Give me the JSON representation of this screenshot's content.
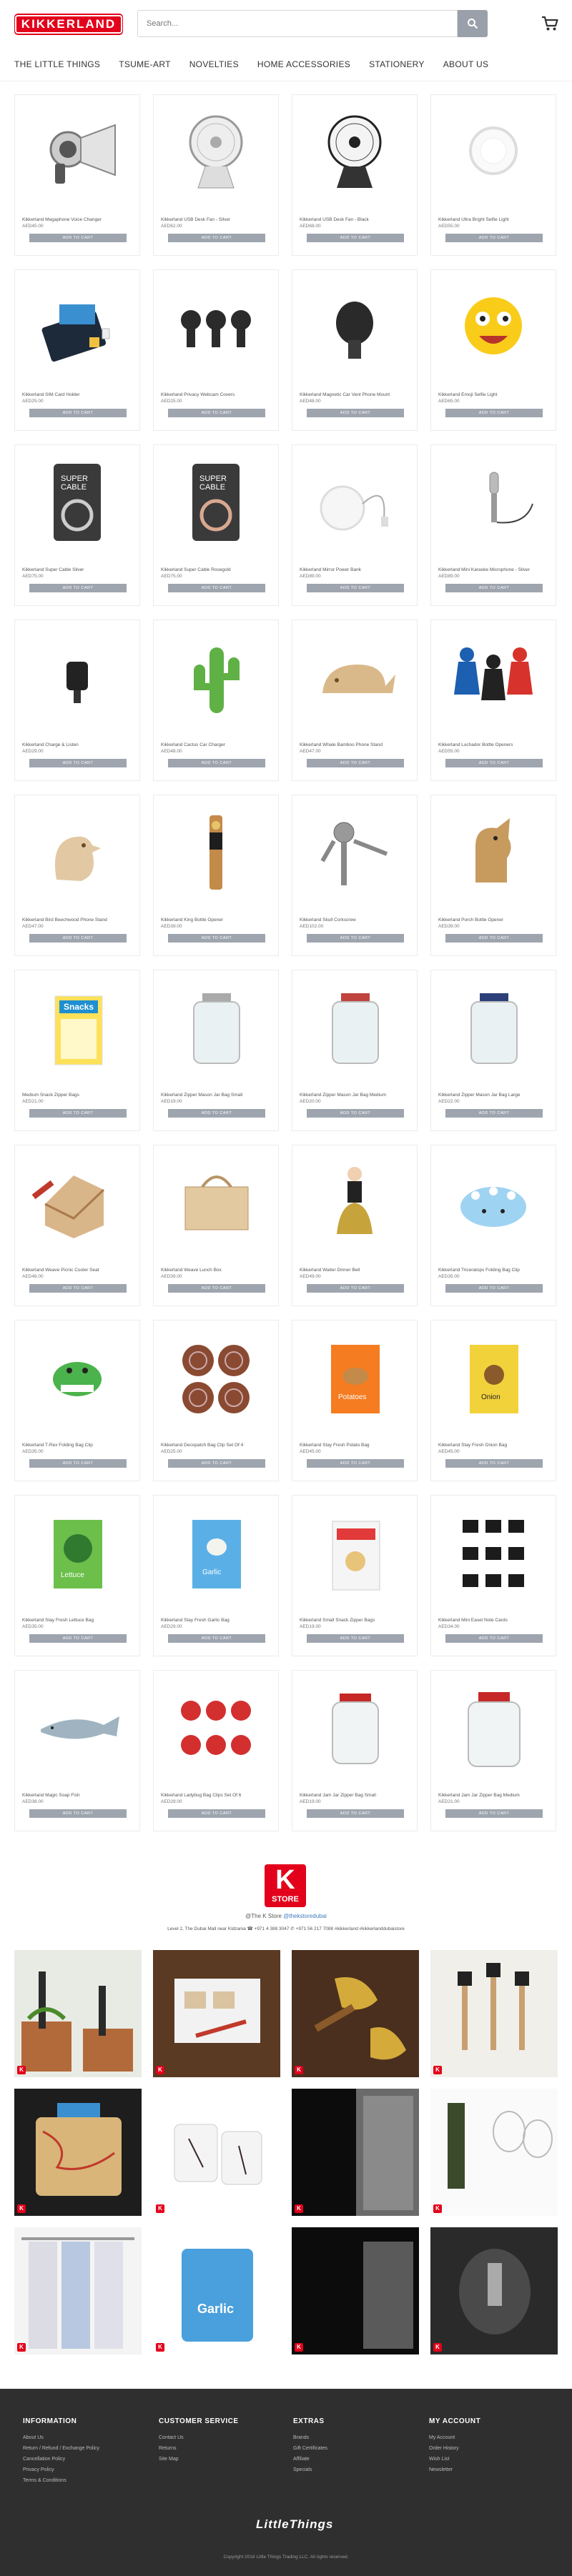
{
  "header": {
    "logo_text": "KIKKERLAND",
    "search_placeholder": "Search..."
  },
  "nav": [
    "THE LITTLE THINGS",
    "TSUME-ART",
    "NOVELTIES",
    "HOME ACCESSORIES",
    "STATIONERY",
    "ABOUT US"
  ],
  "add_label": "ADD TO CART",
  "products": [
    {
      "name": "Kikkerland Megaphone Voice Changer",
      "price": "AED45.00",
      "img": "megaphone"
    },
    {
      "name": "Kikkerland USB Desk Fan - Silver",
      "price": "AED62.00",
      "img": "fan-silver"
    },
    {
      "name": "Kikkerland USB Desk Fan - Black",
      "price": "AED68.00",
      "img": "fan-black"
    },
    {
      "name": "Kikkerland Ultra Bright Selfie Light",
      "price": "AED55.00",
      "img": "selfie-light"
    },
    {
      "name": "Kikkerland SIM Card Holder",
      "price": "AED25.00",
      "img": "sim-holder"
    },
    {
      "name": "Kikkerland Privacy Webcam Covers",
      "price": "AED25.00",
      "img": "webcam-covers"
    },
    {
      "name": "Kikkerland Magnetic Car Vent Phone Mount",
      "price": "AED48.00",
      "img": "car-mount"
    },
    {
      "name": "Kikkerland Emoji Selfie Light",
      "price": "AED65.00",
      "img": "emoji-light"
    },
    {
      "name": "Kikkerland Super Cable Silver",
      "price": "AED75.00",
      "img": "cable-silver"
    },
    {
      "name": "Kikkerland Super Cable Rosegold",
      "price": "AED75.00",
      "img": "cable-rose"
    },
    {
      "name": "Kikkerland Mirror Power Bank",
      "price": "AED89.00",
      "img": "power-bank"
    },
    {
      "name": "Kikkerland Mini Karaoke Microphone - Silver",
      "price": "AED89.00",
      "img": "microphone"
    },
    {
      "name": "Kikkerland Charge & Listen",
      "price": "AED29.00",
      "img": "charge-listen"
    },
    {
      "name": "Kikkerland Cactus Car Charger",
      "price": "AED48.00",
      "img": "cactus"
    },
    {
      "name": "Kikkerland Whale Bamboo Phone Stand",
      "price": "AED47.00",
      "img": "whale"
    },
    {
      "name": "Kikkerland Luchador Bottle Openers",
      "price": "AED55.00",
      "img": "luchador"
    },
    {
      "name": "Kikkerland Bird Beechwood Phone Stand",
      "price": "AED47.00",
      "img": "bird"
    },
    {
      "name": "Kikkerland King Bottle Opener",
      "price": "AED39.00",
      "img": "king-opener"
    },
    {
      "name": "Kikkerland Skull Corkscrew",
      "price": "AED102.00",
      "img": "corkscrew"
    },
    {
      "name": "Kikkerland Porch Bottle Opener",
      "price": "AED39.00",
      "img": "porch-opener"
    },
    {
      "name": "Medium Snack Zipper Bags",
      "price": "AED21.00",
      "img": "snack-bags"
    },
    {
      "name": "Kikkerland Zipper Mason Jar Bag Small",
      "price": "AED19.00",
      "img": "jar-small"
    },
    {
      "name": "Kikkerland Zipper Mason Jar Bag Medium",
      "price": "AED20.00",
      "img": "jar-medium"
    },
    {
      "name": "Kikkerland Zipper Mason Jar Bag Large",
      "price": "AED22.00",
      "img": "jar-large"
    },
    {
      "name": "Kikkerland Weave Picnic Cooler Seat",
      "price": "AED48.00",
      "img": "picnic-seat"
    },
    {
      "name": "Kikkerland Weave Lunch Box",
      "price": "AED39.00",
      "img": "lunch-box"
    },
    {
      "name": "Kikkerland Waiter Dinner Bell",
      "price": "AED49.00",
      "img": "dinner-bell"
    },
    {
      "name": "Kikkerland Triceratops Folding Bag Clip",
      "price": "AED35.00",
      "img": "triceratops"
    },
    {
      "name": "Kikkerland T-Rex Folding Bag Clip",
      "price": "AED35.00",
      "img": "trex"
    },
    {
      "name": "Kikkerland Decopatch Bag Clip Set Of 4",
      "price": "AED25.00",
      "img": "bag-clips"
    },
    {
      "name": "Kikkerland Stay Fresh Potato Bag",
      "price": "AED45.00",
      "img": "potato-bag"
    },
    {
      "name": "Kikkerland Stay Fresh Onion Bag",
      "price": "AED45.00",
      "img": "onion-bag"
    },
    {
      "name": "Kikkerland Stay Fresh Lettuce Bag",
      "price": "AED35.00",
      "img": "lettuce-bag"
    },
    {
      "name": "Kikkerland Stay Fresh Garlic Bag",
      "price": "AED29.00",
      "img": "garlic-bag"
    },
    {
      "name": "Kikkerland Small Snack Zipper Bags",
      "price": "AED19.00",
      "img": "small-snack"
    },
    {
      "name": "Kikkerland Mini Easel Note Cards",
      "price": "AED34.00",
      "img": "easel-cards"
    },
    {
      "name": "Kikkerland Magic Soap Fish",
      "price": "AED38.00",
      "img": "soap-fish"
    },
    {
      "name": "Kikkerland Ladybug Bag Clips Set Of 6",
      "price": "AED29.00",
      "img": "ladybug"
    },
    {
      "name": "Kikkerland Jam Jar Zipper Bag Small",
      "price": "AED19.00",
      "img": "jam-small"
    },
    {
      "name": "Kikkerland Jam Jar Zipper Bag Medium",
      "price": "AED21.00",
      "img": "jam-medium"
    }
  ],
  "social": {
    "store_letter": "K",
    "store_label": "STORE",
    "handle_prefix": "@The K Store",
    "handle_link": "@thekstoredubai",
    "address": "Level 2, The Dubai Mall near Kidzania  ☎ +971 4 388 3047  ✆ +971 56 217 7088  #kikkerland #kikkerlanddubaistore"
  },
  "instagram": [
    "garden-markers",
    "seed-tray",
    "gold-trowel",
    "mini-tools",
    "map-bag",
    "rose-cups",
    "dark-doorway",
    "wine-glasses",
    "shirts",
    "garlic-bag-photo",
    "dark-kitchen",
    "bottle-opener-hand"
  ],
  "footer": {
    "columns": [
      {
        "title": "INFORMATION",
        "links": [
          "About Us",
          "Return / Refund / Exchange Policy",
          "Cancellation Policy",
          "Privacy Policy",
          "Terms & Conditions"
        ]
      },
      {
        "title": "CUSTOMER SERVICE",
        "links": [
          "Contact Us",
          "Returns",
          "Site Map"
        ]
      },
      {
        "title": "EXTRAS",
        "links": [
          "Brands",
          "Gift Certificates",
          "Affiliate",
          "Specials"
        ]
      },
      {
        "title": "MY ACCOUNT",
        "links": [
          "My Account",
          "Order History",
          "Wish List",
          "Newsletter"
        ]
      }
    ],
    "logo_text": "LittleThings",
    "copyright": "Copyright 2018 Little Things Trading LLC. All rights reserved."
  }
}
